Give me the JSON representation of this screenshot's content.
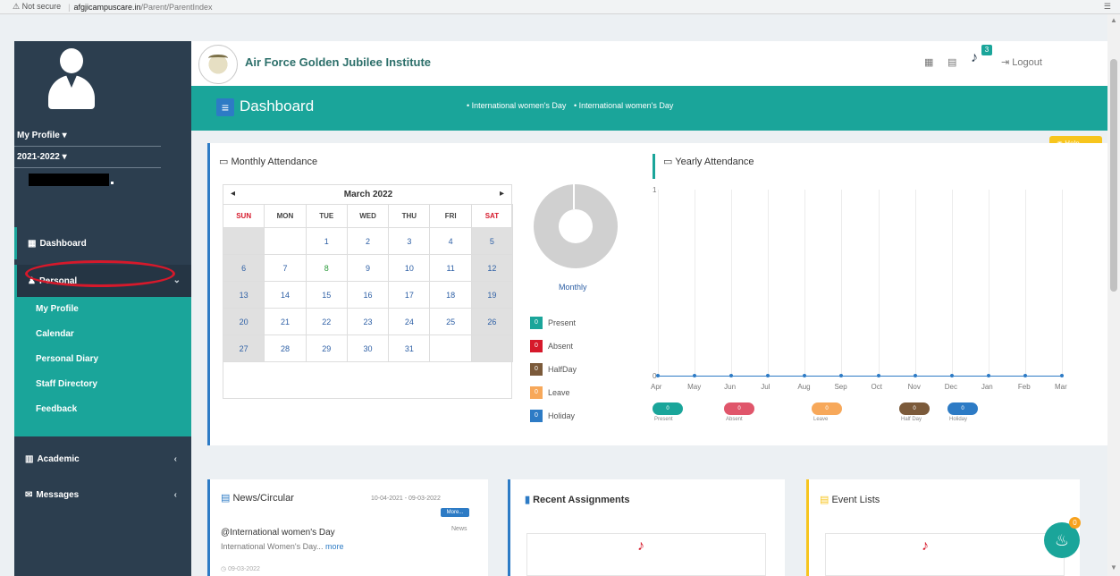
{
  "browser": {
    "warning": "⚠ Not secure",
    "host": "afgjicampuscare.in",
    "path": "/Parent/ParentIndex"
  },
  "sidebar": {
    "profile_menu": "My Profile ▾",
    "year_menu": "2021-2022 ▾",
    "dashboard": "Dashboard",
    "personal": "Personal",
    "personal_items": [
      "My Profile",
      "Calendar",
      "Personal Diary",
      "Staff Directory",
      "Feedback"
    ],
    "academic": "Academic",
    "messages": "Messages"
  },
  "header": {
    "institute": "Air Force Golden Jubilee Institute",
    "notifications": "3",
    "logout": "Logout"
  },
  "titlebar": {
    "title": "Dashboard",
    "ticker": [
      "• International women's Day",
      "• International women's Day"
    ]
  },
  "help": "Help",
  "monthly_attendance": {
    "title": "Monthly Attendance",
    "month": "March 2022",
    "days_of_week": [
      "SUN",
      "MON",
      "TUE",
      "WED",
      "THU",
      "FRI",
      "SAT"
    ],
    "weeks": [
      [
        "",
        "",
        "1",
        "2",
        "3",
        "4",
        "5"
      ],
      [
        "6",
        "7",
        "8",
        "9",
        "10",
        "11",
        "12"
      ],
      [
        "13",
        "14",
        "15",
        "16",
        "17",
        "18",
        "19"
      ],
      [
        "20",
        "21",
        "22",
        "23",
        "24",
        "25",
        "26"
      ],
      [
        "27",
        "28",
        "29",
        "30",
        "31",
        "",
        ""
      ]
    ],
    "donut_label": "Monthly",
    "legend": [
      {
        "label": "Present",
        "count": "0",
        "color": "#1aa59a"
      },
      {
        "label": "Absent",
        "count": "0",
        "color": "#d6192b"
      },
      {
        "label": "HalfDay",
        "count": "0",
        "color": "#7b5a3a"
      },
      {
        "label": "Leave",
        "count": "0",
        "color": "#f7a85a"
      },
      {
        "label": "Holiday",
        "count": "0",
        "color": "#2d7bc5"
      }
    ]
  },
  "yearly_attendance": {
    "title": "Yearly Attendance",
    "y_ticks": [
      "1",
      "0"
    ],
    "months": [
      "Apr",
      "May",
      "Jun",
      "Jul",
      "Aug",
      "Sep",
      "Oct",
      "Nov",
      "Dec",
      "Jan",
      "Feb",
      "Mar"
    ],
    "pills": [
      {
        "label": "Present",
        "count": "0",
        "color": "#1aa59a"
      },
      {
        "label": "Absent",
        "count": "0",
        "color": "#e0566b"
      },
      {
        "label": "Leave",
        "count": "0",
        "color": "#f7a85a"
      },
      {
        "label": "Half Day",
        "count": "0",
        "color": "#7b5a3a"
      },
      {
        "label": "Holiday",
        "count": "0",
        "color": "#2d7bc5"
      }
    ]
  },
  "news": {
    "title": "News/Circular",
    "range": "10-04-2021 - 09-03-2022",
    "more": "More...",
    "tag": "News",
    "headline": "@International women's Day",
    "snippet": "International Women's Day...",
    "more_link": "more",
    "date": "09-03-2022"
  },
  "assignments": {
    "title": "Recent Assignments"
  },
  "events": {
    "title": "Event Lists"
  },
  "float_badge": "0"
}
